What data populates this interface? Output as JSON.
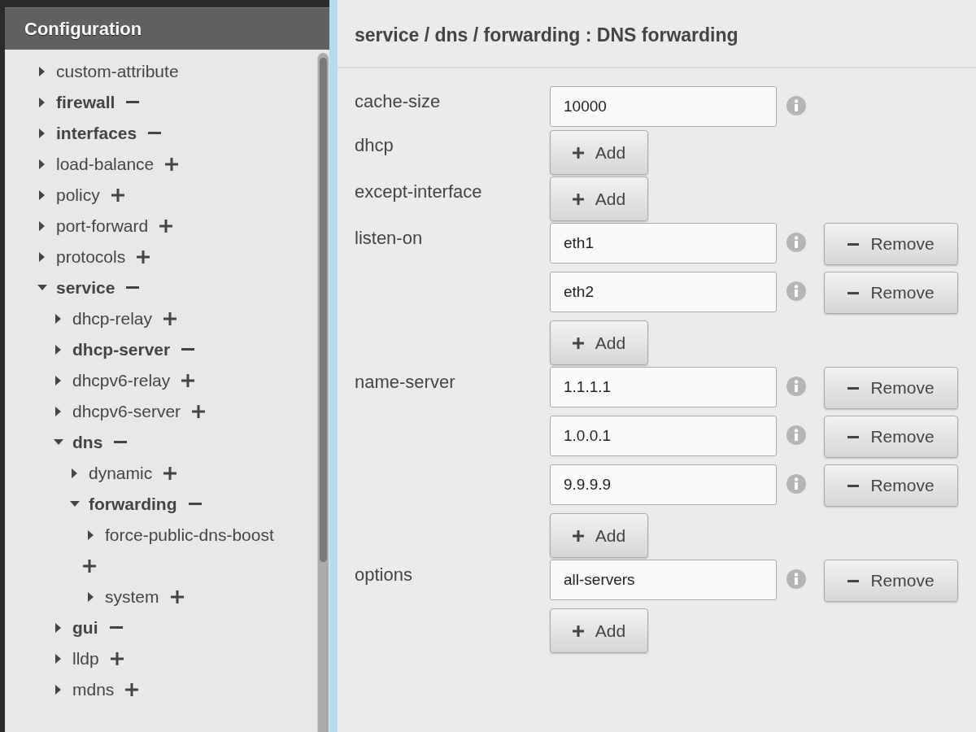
{
  "sidebar": {
    "title": "Configuration",
    "items": [
      {
        "label": "custom-attribute",
        "configured": false,
        "show_toggle": false,
        "expanded": false
      },
      {
        "label": "firewall",
        "configured": true,
        "show_toggle": true,
        "expanded": false
      },
      {
        "label": "interfaces",
        "configured": true,
        "show_toggle": true,
        "expanded": false
      },
      {
        "label": "load-balance",
        "configured": false,
        "show_toggle": true,
        "expanded": false
      },
      {
        "label": "policy",
        "configured": false,
        "show_toggle": true,
        "expanded": false
      },
      {
        "label": "port-forward",
        "configured": false,
        "show_toggle": true,
        "expanded": false
      },
      {
        "label": "protocols",
        "configured": false,
        "show_toggle": true,
        "expanded": false
      },
      {
        "label": "service",
        "configured": true,
        "show_toggle": true,
        "expanded": true,
        "children": [
          {
            "label": "dhcp-relay",
            "configured": false,
            "show_toggle": true,
            "expanded": false
          },
          {
            "label": "dhcp-server",
            "configured": true,
            "show_toggle": true,
            "expanded": false
          },
          {
            "label": "dhcpv6-relay",
            "configured": false,
            "show_toggle": true,
            "expanded": false
          },
          {
            "label": "dhcpv6-server",
            "configured": false,
            "show_toggle": true,
            "expanded": false
          },
          {
            "label": "dns",
            "configured": true,
            "show_toggle": true,
            "expanded": true,
            "children": [
              {
                "label": "dynamic",
                "configured": false,
                "show_toggle": true,
                "expanded": false
              },
              {
                "label": "forwarding",
                "configured": true,
                "show_toggle": true,
                "expanded": true,
                "children": [
                  {
                    "label": "force-public-dns-boost",
                    "configured": false,
                    "show_toggle": true,
                    "expanded": false,
                    "wrap_toggle": true
                  },
                  {
                    "label": "system",
                    "configured": false,
                    "show_toggle": true,
                    "expanded": false
                  }
                ]
              }
            ]
          },
          {
            "label": "gui",
            "configured": true,
            "show_toggle": true,
            "expanded": false
          },
          {
            "label": "lldp",
            "configured": false,
            "show_toggle": true,
            "expanded": false
          },
          {
            "label": "mdns",
            "configured": false,
            "show_toggle": true,
            "expanded": false
          }
        ]
      }
    ]
  },
  "panel": {
    "title": "service / dns / forwarding : DNS forwarding",
    "fields": [
      {
        "label": "cache-size",
        "kind": "single",
        "values": [
          {
            "value": "10000"
          }
        ]
      },
      {
        "label": "dhcp",
        "kind": "multi",
        "add_label": "Add"
      },
      {
        "label": "except-interface",
        "kind": "multi",
        "add_label": "Add"
      },
      {
        "label": "listen-on",
        "kind": "multi",
        "values": [
          {
            "value": "eth1",
            "remove_label": "Remove"
          },
          {
            "value": "eth2",
            "remove_label": "Remove"
          }
        ],
        "add_label": "Add"
      },
      {
        "label": "name-server",
        "kind": "multi",
        "values": [
          {
            "value": "1.1.1.1",
            "remove_label": "Remove"
          },
          {
            "value": "1.0.0.1",
            "remove_label": "Remove"
          },
          {
            "value": "9.9.9.9",
            "remove_label": "Remove"
          }
        ],
        "add_label": "Add"
      },
      {
        "label": "options",
        "kind": "multi",
        "values": [
          {
            "value": "all-servers",
            "remove_label": "Remove"
          }
        ],
        "add_label": "Add"
      }
    ]
  }
}
